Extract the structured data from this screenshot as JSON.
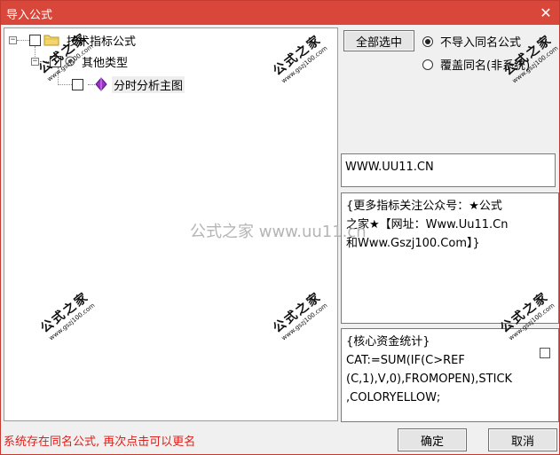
{
  "window": {
    "title": "导入公式"
  },
  "tree": {
    "root": {
      "label": "技术指标公式",
      "expander": "−"
    },
    "child": {
      "label": "其他类型",
      "expander": "−"
    },
    "leaf": {
      "label": "分时分析主图"
    }
  },
  "options": {
    "select_all_label": "全部选中",
    "radio_no_import": "不导入同名公式",
    "radio_overwrite": "覆盖同名(非系统)",
    "selected_radio": "不导入同名公式"
  },
  "name_field": {
    "value": "WWW.UU11.CN"
  },
  "description": {
    "lines": [
      "{更多指标关注公众号：★公式",
      "之家★【网址：Www.Uu11.Cn",
      "和Www.Gszj100.Com】}"
    ]
  },
  "code": {
    "lines": [
      "{核心资金统计}",
      "CAT:=SUM(IF(C>REF",
      "(C,1),V,0),FROMOPEN),STICK",
      ",COLORYELLOW;"
    ]
  },
  "status": {
    "message": "系统存在同名公式, 再次点击可以更名"
  },
  "buttons": {
    "ok": "确定",
    "cancel": "取消"
  },
  "watermark": {
    "brand": "公式之家",
    "url": "www.gszj100.com",
    "center": "公式之家 www.uu11.cn"
  }
}
